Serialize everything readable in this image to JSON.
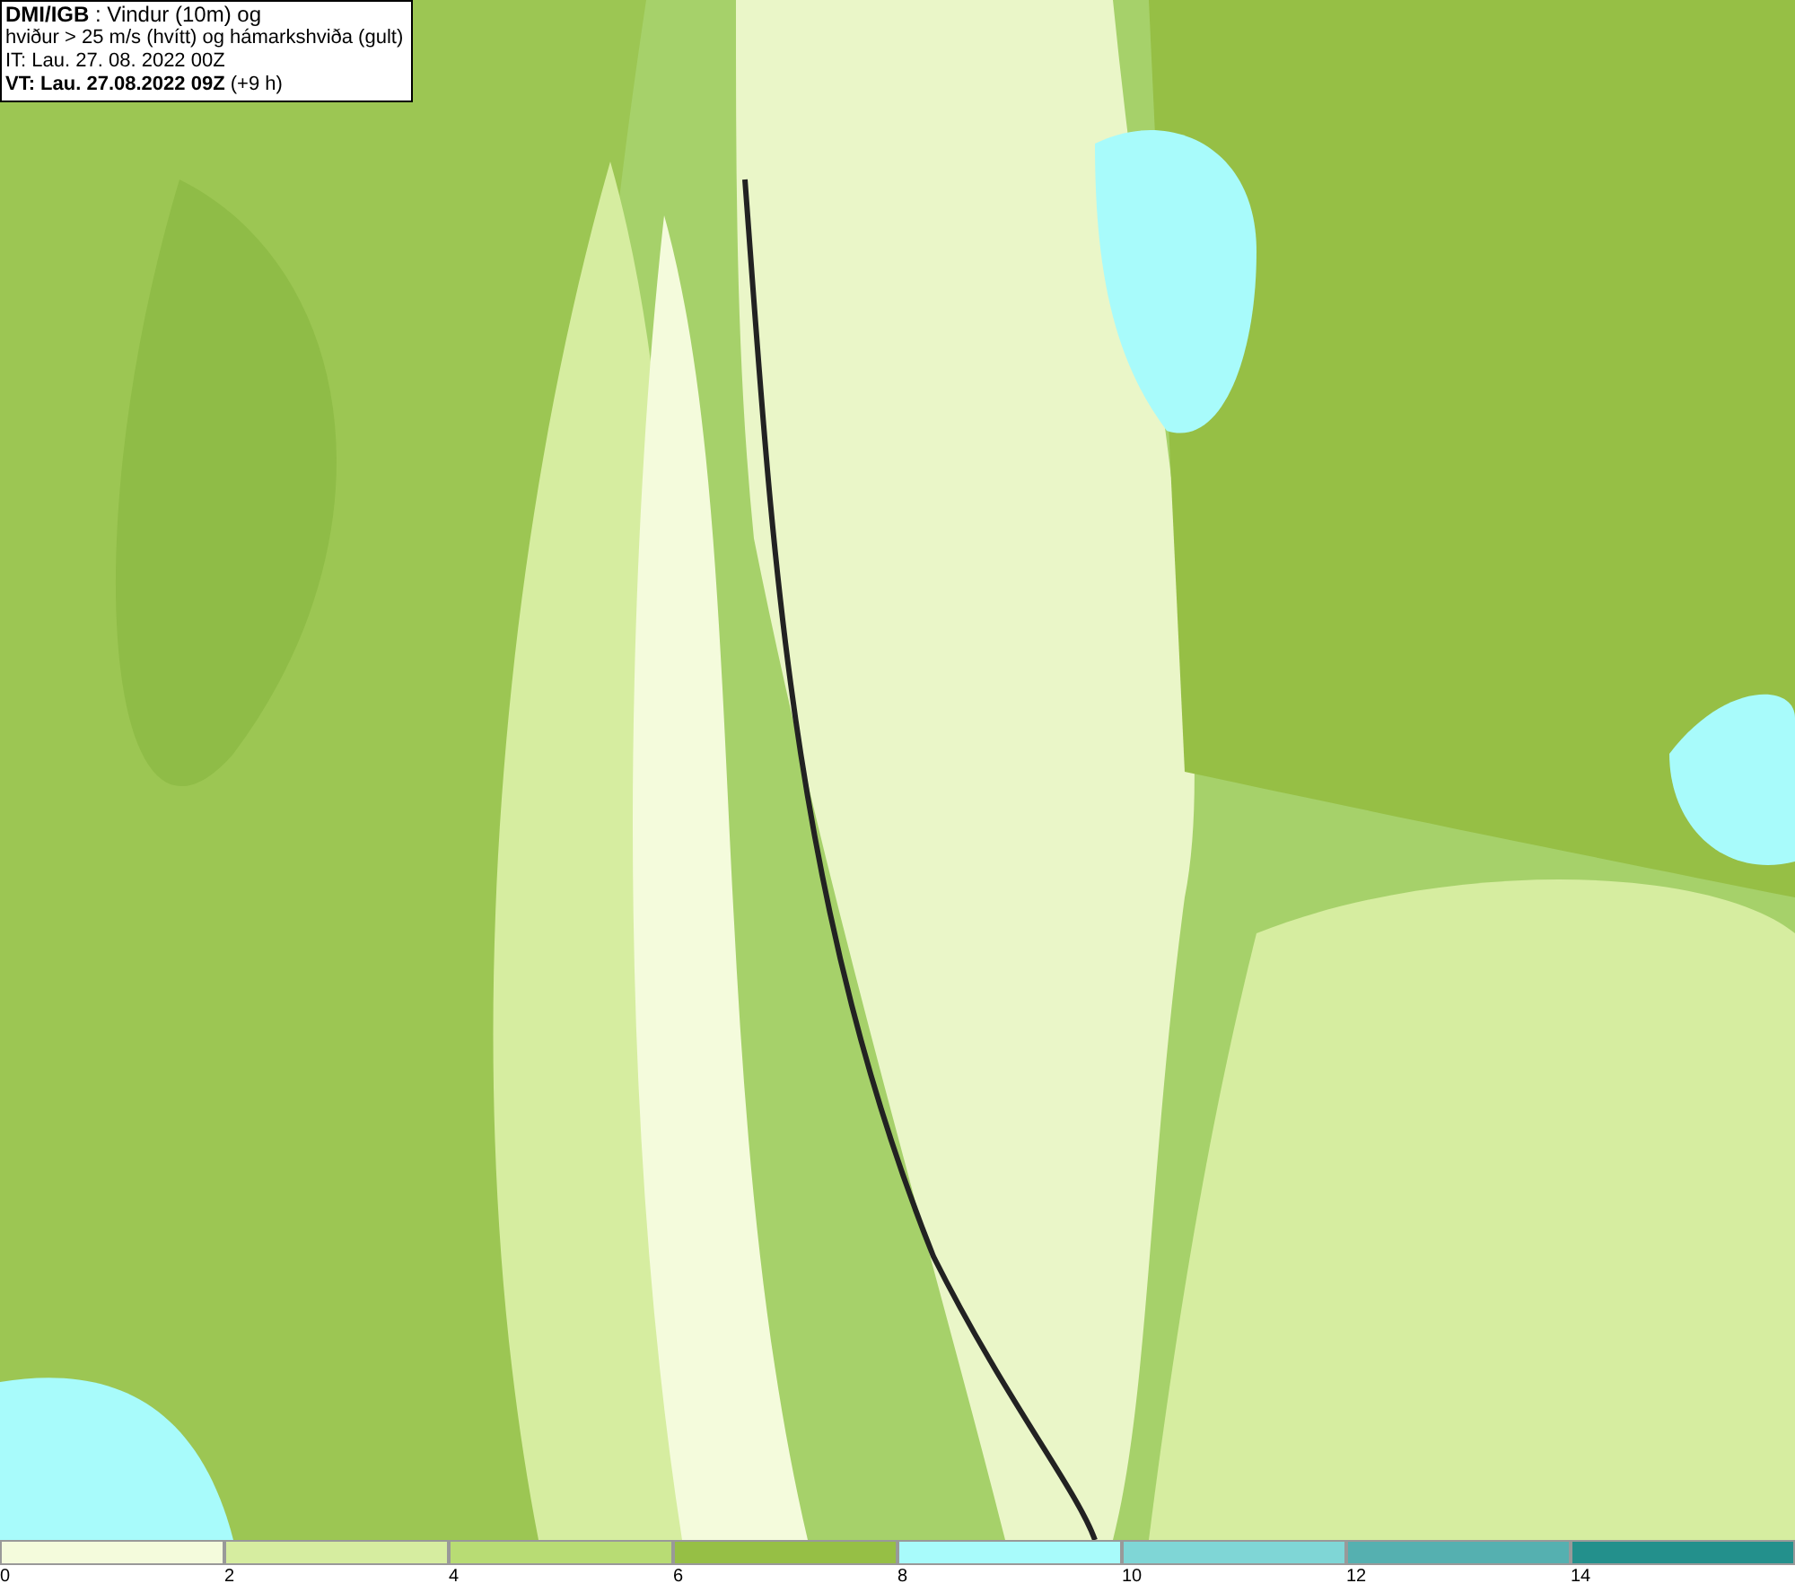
{
  "info_box": {
    "lines": [
      "**DMI/IGB** : Vindur (10m) og",
      "hviður > 25 m/s (hvítt) og hámarkshviða (gult)",
      "IT: Lau. 27. 08. 2022 00Z",
      "**VT: Lau. 27.08.2022 09Z** (+9 h)"
    ]
  },
  "color_scale": [
    {
      "label": "0",
      "color": "#f4fbdc"
    },
    {
      "label": "2",
      "color": "#d6eda0"
    },
    {
      "label": "4",
      "color": "#b8dc74"
    },
    {
      "label": "6",
      "color": "#96bf45"
    },
    {
      "label": "8",
      "color": "#a8fbfb"
    },
    {
      "label": "10",
      "color": "#7fd6d6"
    },
    {
      "label": "12",
      "color": "#55b0b0"
    },
    {
      "label": "14",
      "color": "#23908c"
    }
  ]
}
